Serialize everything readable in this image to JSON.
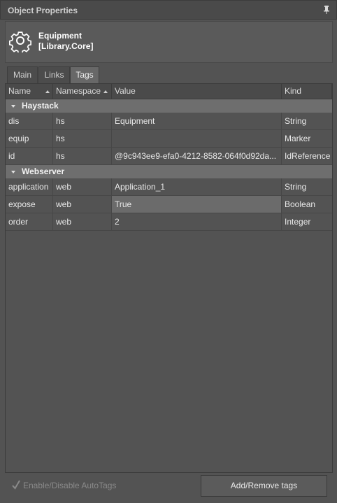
{
  "panel": {
    "title": "Object Properties",
    "pin_icon": "pin-icon"
  },
  "object": {
    "icon": "gear-icon",
    "name": "Equipment",
    "library": "[Library.Core]"
  },
  "tabs": [
    {
      "label": "Main",
      "active": false
    },
    {
      "label": "Links",
      "active": false
    },
    {
      "label": "Tags",
      "active": true
    }
  ],
  "columns": {
    "name": "Name",
    "namespace": "Namespace",
    "value": "Value",
    "kind": "Kind"
  },
  "groups": [
    {
      "name": "Haystack",
      "rows": [
        {
          "name": "dis",
          "namespace": "hs",
          "value": "Equipment",
          "kind": "String"
        },
        {
          "name": "equip",
          "namespace": "hs",
          "value": "",
          "kind": "Marker"
        },
        {
          "name": "id",
          "namespace": "hs",
          "value": "@9c943ee9-efa0-4212-8582-064f0d92da...",
          "kind": "IdReference"
        }
      ]
    },
    {
      "name": "Webserver",
      "rows": [
        {
          "name": "application",
          "namespace": "web",
          "value": "Application_1",
          "kind": "String"
        },
        {
          "name": "expose",
          "namespace": "web",
          "value": "True",
          "kind": "Boolean",
          "selected": true
        },
        {
          "name": "order",
          "namespace": "web",
          "value": "2",
          "kind": "Integer"
        }
      ]
    }
  ],
  "footer": {
    "autotags_label": "Enable/Disable AutoTags",
    "autotags_checked": true,
    "autotags_enabled": false,
    "add_remove_label": "Add/Remove tags"
  },
  "colors": {
    "background": "#535353",
    "group_header": "#6e6e6e",
    "selected_cell": "#6b6b6b"
  }
}
